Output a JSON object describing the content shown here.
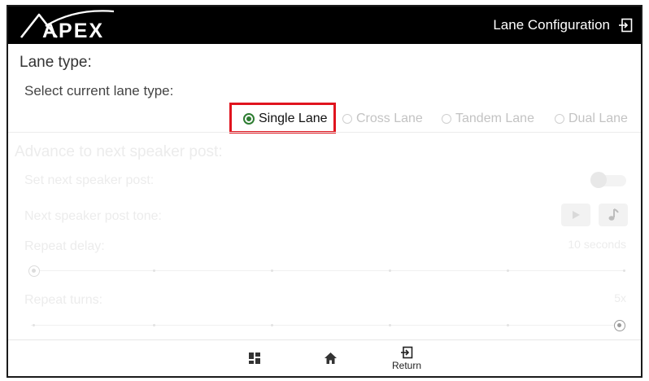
{
  "header": {
    "brand": "APEX",
    "title": "Lane Configuration",
    "exit_icon": "exit-icon"
  },
  "lane_type": {
    "heading": "Lane type:",
    "prompt": "Select current lane type:",
    "options": [
      "Single Lane",
      "Cross Lane",
      "Tandem Lane",
      "Dual Lane"
    ],
    "selected": "Single Lane"
  },
  "advance": {
    "heading": "Advance to next speaker post:",
    "set_next_label": "Set next speaker post:",
    "set_next_enabled": false,
    "tone_label": "Next speaker post tone:",
    "play_icon": "play-icon",
    "music_icon": "music-note-icon",
    "repeat_delay_label": "Repeat delay:",
    "repeat_delay_value": "10 seconds",
    "repeat_turns_label": "Repeat turns:",
    "repeat_turns_value": "5x"
  },
  "bottom_nav": {
    "dashboard_icon": "dashboard-icon",
    "home_icon": "home-icon",
    "return_label": "Return",
    "return_icon": "return-icon"
  },
  "colors": {
    "highlight": "#e0141e",
    "radio_selected": "#2e7d32",
    "topbar": "#000000"
  }
}
